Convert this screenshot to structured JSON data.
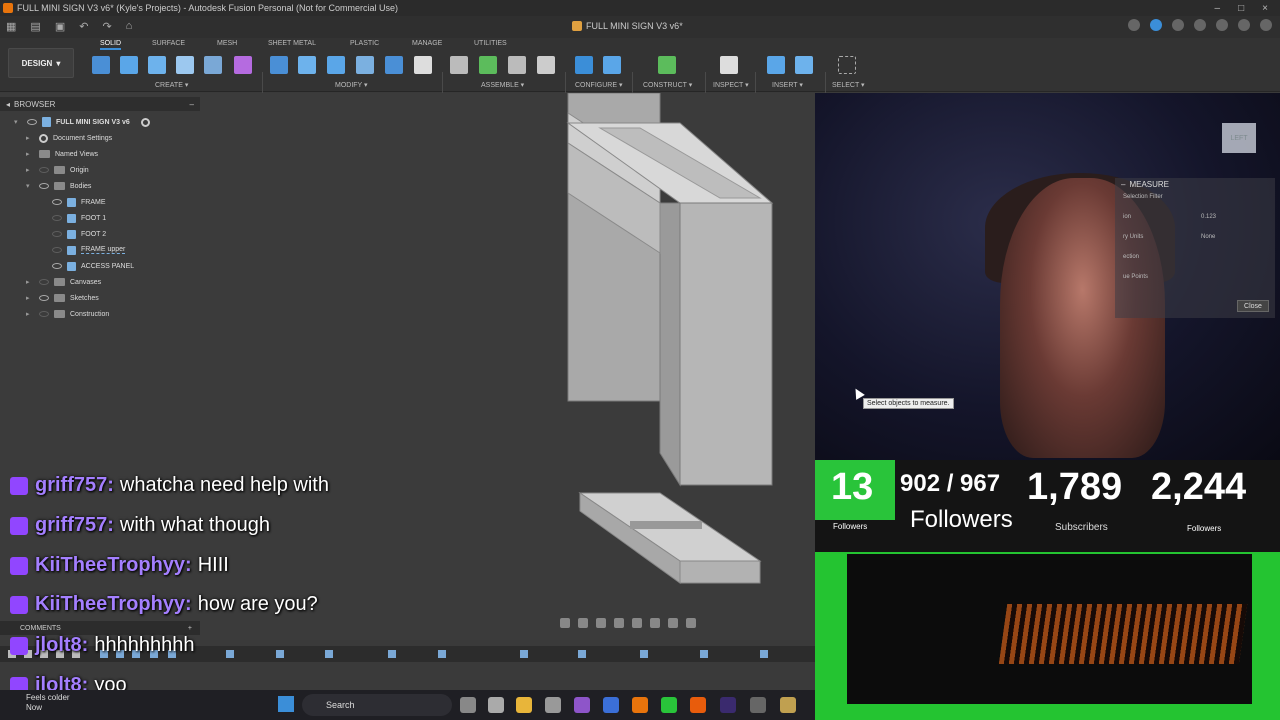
{
  "window": {
    "title": "FULL MINI SIGN V3 v6* (Kyle's Projects) - Autodesk Fusion Personal (Not for Commercial Use)",
    "controls": [
      "–",
      "□",
      "×"
    ]
  },
  "tabs": {
    "active": "FULL MINI SIGN V3 v6*"
  },
  "toolbar": {
    "workspace": "DESIGN",
    "tabs": [
      "SOLID",
      "SURFACE",
      "MESH",
      "SHEET METAL",
      "PLASTIC",
      "MANAGE",
      "UTILITIES"
    ],
    "groups": [
      "CREATE ▾",
      "MODIFY ▾",
      "ASSEMBLE ▾",
      "CONFIGURE ▾",
      "CONSTRUCT ▾",
      "INSPECT ▾",
      "INSERT ▾",
      "SELECT ▾"
    ]
  },
  "browser": {
    "title": "BROWSER",
    "root": "FULL MINI SIGN V3 v6",
    "items": [
      {
        "label": "Document Settings"
      },
      {
        "label": "Named Views"
      },
      {
        "label": "Origin"
      },
      {
        "label": "Bodies"
      },
      {
        "label": "FRAME"
      },
      {
        "label": "FOOT 1"
      },
      {
        "label": "FOOT 2"
      },
      {
        "label": "FRAME upper"
      },
      {
        "label": "ACCESS PANEL"
      },
      {
        "label": "Canvases"
      },
      {
        "label": "Sketches"
      },
      {
        "label": "Construction"
      }
    ]
  },
  "comments": {
    "label": "COMMENTS",
    "add": "+"
  },
  "measure": {
    "title": "MEASURE",
    "rows": [
      "Selection Filter",
      "ion",
      "0.123",
      "ry Units",
      "None",
      "ection",
      "ue Points"
    ],
    "close": "Close",
    "tooltip": "Select objects to measure."
  },
  "viewcube": {
    "label": "LEFT"
  },
  "stats": {
    "green_num": "13",
    "green_label": "Followers",
    "goal": "902 / 967",
    "goal_label": "Followers",
    "subs": "1,789",
    "subs_label": "Subscribers",
    "followers": "2,244",
    "followers_label": "Followers"
  },
  "chat": [
    {
      "user": "griff757:",
      "msg": "whatcha need help with"
    },
    {
      "user": "griff757:",
      "msg": "with what though"
    },
    {
      "user": "KiiTheeTrophyy:",
      "msg": "HIII"
    },
    {
      "user": "KiiTheeTrophyy:",
      "msg": "how are you?"
    },
    {
      "user": "jlolt8:",
      "msg": "hhhhhhhhh"
    },
    {
      "user": "jlolt8:",
      "msg": "yoo"
    }
  ],
  "taskbar": {
    "weather_title": "Feels colder",
    "weather_sub": "Now",
    "search": "Search"
  },
  "colors": {
    "accent": "#3b8ed8",
    "chat_user": "#a47fff",
    "twitch": "#9146ff",
    "overlay_green": "#29c43a"
  }
}
